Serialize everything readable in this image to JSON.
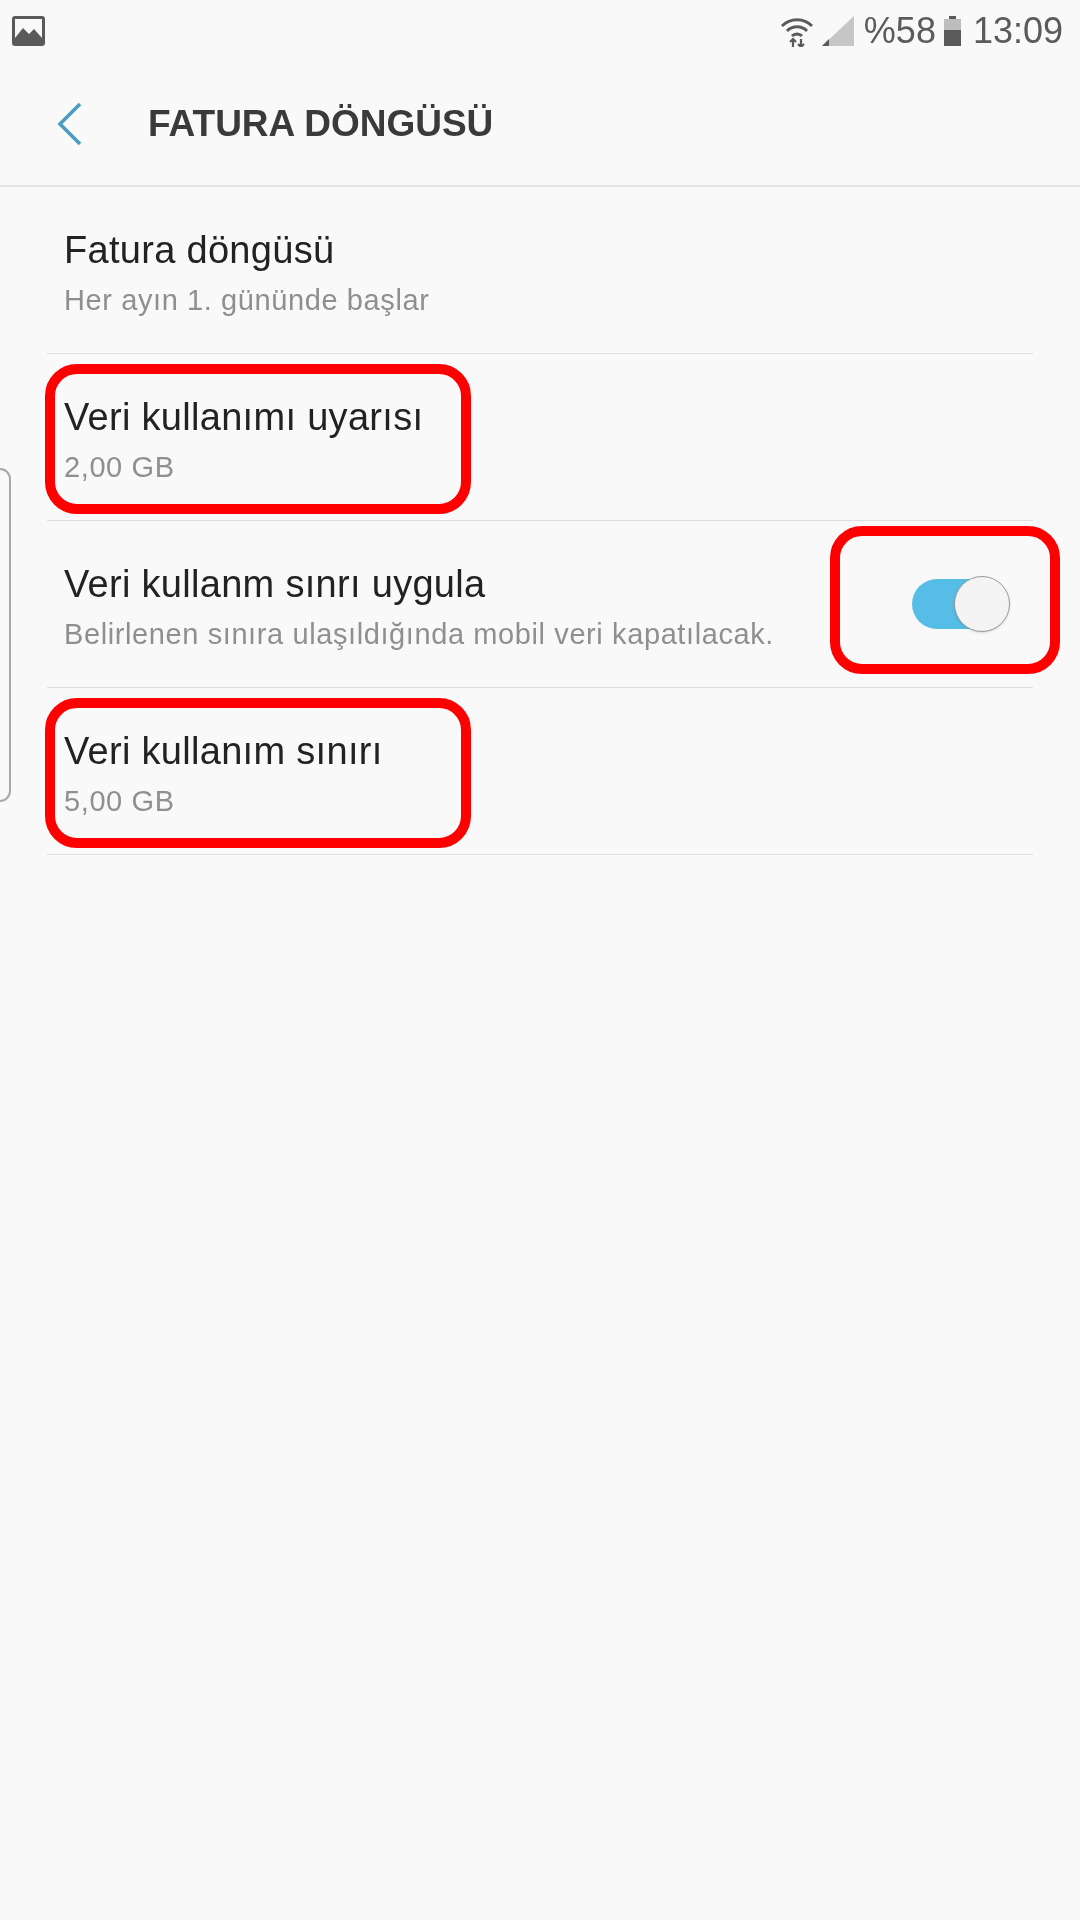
{
  "status_bar": {
    "battery": "%58",
    "time": "13:09"
  },
  "header": {
    "title": "FATURA DÖNGÜSÜ"
  },
  "settings": [
    {
      "kind": "value",
      "title": "Fatura döngüsü",
      "subtitle": "Her ayın 1. gününde başlar",
      "highlighted": false
    },
    {
      "kind": "value",
      "title": "Veri kullanımı uyarısı",
      "subtitle": "2,00 GB",
      "highlighted": true
    },
    {
      "kind": "switch",
      "title": "Veri kullanm sınrı uygula",
      "subtitle": "Belirlenen sınıra ulaşıldığında mobil veri kapatılacak.",
      "highlighted": false,
      "switch": {
        "on": true,
        "highlighted": true
      }
    },
    {
      "kind": "value",
      "title": "Veri kullanım sınırı",
      "subtitle": "5,00 GB",
      "highlighted": true
    }
  ]
}
